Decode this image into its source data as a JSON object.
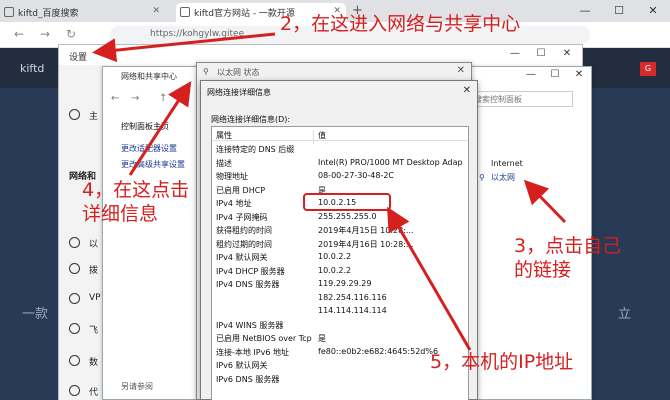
{
  "browser": {
    "tabs": [
      {
        "label": "kiftd_百度搜索"
      },
      {
        "label": "kiftd官方网站 - 一款开源"
      }
    ],
    "new_tab": "+",
    "url_text": "https://kohgylw.gitee",
    "win": {
      "min": "—",
      "max": "☐",
      "close": "✕"
    }
  },
  "site": {
    "logo": "kiftd",
    "badge": "G",
    "left_text": "一款",
    "right_text": "立"
  },
  "settings": {
    "title": "设置",
    "win": {
      "min": "—",
      "max": "☐",
      "close": "✕"
    },
    "nav_labels": [
      "主",
      "网络和",
      "以",
      "拨",
      "VP",
      "飞",
      "数",
      "代"
    ]
  },
  "netshare": {
    "title": "网络和共享中心",
    "nav": [
      "←",
      "→",
      "↑"
    ],
    "search_placeholder": "搜索控制面板",
    "links": [
      "控制面板主页",
      "更改适配器设置",
      "更改高级共享设置"
    ],
    "internet": "Internet",
    "ethernet": "以太网",
    "see_also": "另请参阅",
    "win": {
      "min": "—",
      "max": "☐",
      "close": "✕"
    }
  },
  "ethstatus": {
    "title": "以太网 状态",
    "close": "✕"
  },
  "details": {
    "title": "网络连接详细信息",
    "close": "✕",
    "label": "网络连接详细信息(D):",
    "col_property": "属性",
    "col_value": "值",
    "rows": [
      {
        "p": "连接特定的 DNS 后缀",
        "v": ""
      },
      {
        "p": "描述",
        "v": "Intel(R) PRO/1000 MT Desktop Adap"
      },
      {
        "p": "物理地址",
        "v": "08-00-27-30-48-2C"
      },
      {
        "p": "已启用 DHCP",
        "v": "是"
      },
      {
        "p": "IPv4 地址",
        "v": "10.0.2.15"
      },
      {
        "p": "IPv4 子网掩码",
        "v": "255.255.255.0"
      },
      {
        "p": "获得租约的时间",
        "v": "2019年4月15日 10:28:..."
      },
      {
        "p": "租约过期的时间",
        "v": "2019年4月16日 10:28:..."
      },
      {
        "p": "IPv4 默认网关",
        "v": "10.0.2.2"
      },
      {
        "p": "IPv4 DHCP 服务器",
        "v": "10.0.2.2"
      },
      {
        "p": "IPv4 DNS 服务器",
        "v": "119.29.29.29"
      },
      {
        "p": "",
        "v": "182.254.116.116"
      },
      {
        "p": "",
        "v": "114.114.114.114"
      },
      {
        "p": "IPv4 WINS 服务器",
        "v": ""
      },
      {
        "p": "已启用 NetBIOS over Tcp",
        "v": "是"
      },
      {
        "p": "连接-本地 IPv6 地址",
        "v": "fe80::e0b2:e682:4645:52d%6"
      },
      {
        "p": "IPv6 默认网关",
        "v": ""
      },
      {
        "p": "IPv6 DNS 服务器",
        "v": ""
      }
    ]
  },
  "annotations": {
    "step2": "2，在这进入网络与共享中心",
    "step3_line1": "3，点击自己",
    "step3_line2": "的链接",
    "step4_line1": "4，在这点击",
    "step4_line2": "详细信息",
    "step5": "5，本机的IP地址",
    "color": "#d61f1f"
  }
}
